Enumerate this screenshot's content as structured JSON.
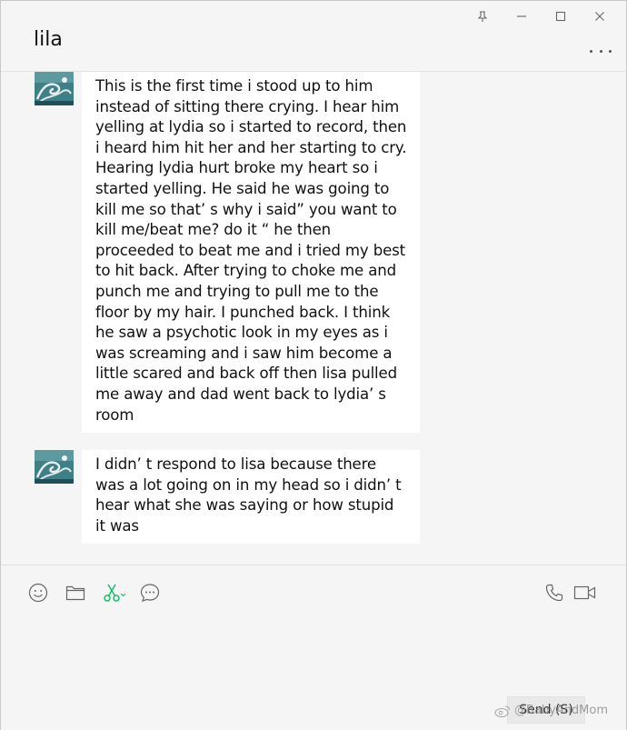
{
  "header": {
    "title": "lila"
  },
  "window_controls": [
    "pin-icon",
    "minimize-icon",
    "maximize-icon",
    "close-icon"
  ],
  "messages": [
    {
      "sender": "lila",
      "text": "This is the first time i stood up to him instead of sitting there crying. I hear him yelling at lydia so i started to record, then i heard him hit her and her starting to cry. Hearing lydia hurt broke my heart so i started yelling. He said he was going to kill me so that’ s why i said” you want to kill me/beat me? do it “ he then proceeded to beat me and i tried my best to hit back. After trying to choke me and punch me and trying to pull me to the floor by my hair. I punched back. I think he saw a psychotic look in my eyes as i was screaming and i saw him become a little scared and back off then lisa pulled me away and dad went back to lydia’ s room"
    },
    {
      "sender": "lila",
      "text": "I didn’ t respond to lisa because there was a lot going on in my head so i didn’ t hear what she was saying or how stupid it was"
    }
  ],
  "toolbar": {
    "left_icons": [
      "emoji-icon",
      "folder-icon",
      "scissors-icon",
      "chat-history-icon"
    ],
    "right_icons": [
      "phone-icon",
      "video-call-icon"
    ]
  },
  "composer": {
    "input_value": "",
    "send_label": "Send (S)"
  },
  "watermark": {
    "text": "@BabyAndMom"
  },
  "colors": {
    "background": "#f5f5f5",
    "bubble": "#ffffff",
    "accent_green": "#07c160"
  }
}
